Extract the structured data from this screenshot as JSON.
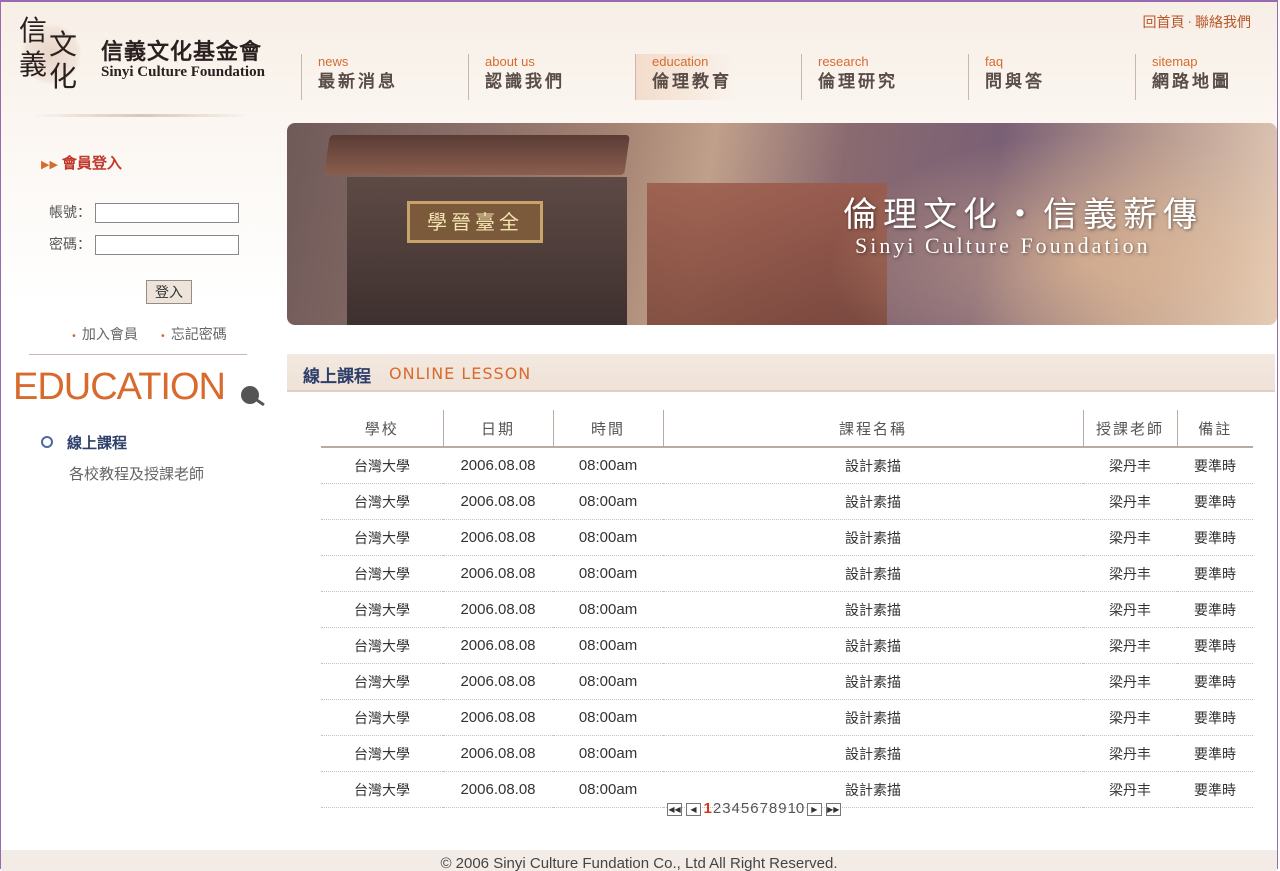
{
  "logo": {
    "seal_chars": [
      "信",
      "文",
      "義",
      "化"
    ],
    "name_cn": "信義文化基金會",
    "name_en": "Sinyi Culture Foundation"
  },
  "toplinks": {
    "home": "回首頁",
    "separator": "·",
    "contact": "聯絡我們"
  },
  "nav": [
    {
      "en": "news",
      "cn": "最新消息"
    },
    {
      "en": "about us",
      "cn": "認識我們"
    },
    {
      "en": "education",
      "cn": "倫理教育",
      "active": true
    },
    {
      "en": "research",
      "cn": "倫理研究"
    },
    {
      "en": "faq",
      "cn": "問與答"
    },
    {
      "en": "sitemap",
      "cn": "網路地圖"
    }
  ],
  "banner": {
    "plaque": "學晉臺全",
    "title_cn": "倫理文化・信義薪傳",
    "title_en": "Sinyi Culture Foundation"
  },
  "login": {
    "title": "會員登入",
    "account_label": "帳號：",
    "password_label": "密碼：",
    "account_value": "",
    "password_value": "",
    "submit": "登入",
    "join": "加入會員",
    "forgot": "忘記密碼"
  },
  "sidebar": {
    "heading": "EDUCATION",
    "menu": [
      {
        "label": "線上課程",
        "active": true
      },
      {
        "label": "各校教程及授課老師",
        "active": false
      }
    ]
  },
  "section": {
    "title_cn": "線上課程",
    "title_en": "ONLINE LESSON"
  },
  "table": {
    "headers": [
      "學校",
      "日期",
      "時間",
      "課程名稱",
      "授課老師",
      "備註"
    ],
    "rows": [
      [
        "台灣大學",
        "2006.08.08",
        "08:00am",
        "設計素描",
        "梁丹丰",
        "要準時"
      ],
      [
        "台灣大學",
        "2006.08.08",
        "08:00am",
        "設計素描",
        "梁丹丰",
        "要準時"
      ],
      [
        "台灣大學",
        "2006.08.08",
        "08:00am",
        "設計素描",
        "梁丹丰",
        "要準時"
      ],
      [
        "台灣大學",
        "2006.08.08",
        "08:00am",
        "設計素描",
        "梁丹丰",
        "要準時"
      ],
      [
        "台灣大學",
        "2006.08.08",
        "08:00am",
        "設計素描",
        "梁丹丰",
        "要準時"
      ],
      [
        "台灣大學",
        "2006.08.08",
        "08:00am",
        "設計素描",
        "梁丹丰",
        "要準時"
      ],
      [
        "台灣大學",
        "2006.08.08",
        "08:00am",
        "設計素描",
        "梁丹丰",
        "要準時"
      ],
      [
        "台灣大學",
        "2006.08.08",
        "08:00am",
        "設計素描",
        "梁丹丰",
        "要準時"
      ],
      [
        "台灣大學",
        "2006.08.08",
        "08:00am",
        "設計素描",
        "梁丹丰",
        "要準時"
      ],
      [
        "台灣大學",
        "2006.08.08",
        "08:00am",
        "設計素描",
        "梁丹丰",
        "要準時"
      ]
    ]
  },
  "pager": {
    "pages": [
      "1",
      "2",
      "3",
      "4",
      "5",
      "6",
      "7",
      "8",
      "9",
      "10"
    ],
    "current": "1",
    "first_icon": "first-page-icon",
    "prev_icon": "prev-page-icon",
    "next_icon": "next-page-icon",
    "last_icon": "last-page-icon"
  },
  "footer": {
    "copyright": "© 2006 Sinyi Culture Fundation Co., Ltd All Right Reserved."
  },
  "colors": {
    "accent_orange": "#d86a2e",
    "accent_navy": "#2d3f6a",
    "frame_border": "#9a6ab0"
  }
}
